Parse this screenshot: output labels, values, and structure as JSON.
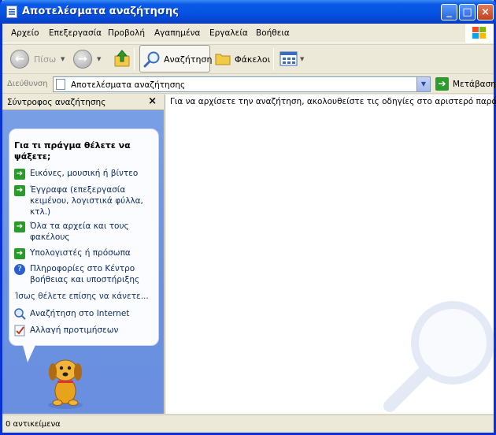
{
  "window": {
    "title": "Αποτελέσματα αναζήτησης"
  },
  "menu": [
    "Αρχείο",
    "Επεξεργασία",
    "Προβολή",
    "Αγαπημένα",
    "Εργαλεία",
    "Βοήθεια"
  ],
  "toolbar": {
    "back_label": "Πίσω",
    "search_label": "Αναζήτηση",
    "folders_label": "Φάκελοι"
  },
  "address": {
    "label": "Διεύθυνση",
    "value": "Αποτελέσματα αναζήτησης",
    "go_label": "Μετάβαση"
  },
  "search_pane": {
    "header": "Σύντροφος αναζήτησης",
    "close_symbol": "×",
    "question": "Για τι πράγμα θέλετε να ψάξετε;",
    "options": [
      "Εικόνες, μουσική ή βίντεο",
      "Έγγραφα (επεξεργασία κειμένου, λογιστικά φύλλα, κτλ.)",
      "Όλα τα αρχεία και τους φακέλους",
      "Υπολογιστές ή πρόσωπα",
      "Πληροφορίες στο Κέντρο βοήθειας και υποστήριξης"
    ],
    "also_title": "Ίσως θέλετε επίσης να κάνετε...",
    "also_items": [
      "Αναζήτηση στο Internet",
      "Αλλαγή προτιμήσεων"
    ]
  },
  "results": {
    "instructions": "Για να αρχίσετε την αναζήτηση, ακολουθείστε τις οδηγίες στο αριστερό παράθυρο."
  },
  "status": {
    "text": "0 αντικείμενα"
  },
  "colors": {
    "title_blue": "#0554e3",
    "pane_blue": "#6b90e0",
    "chrome": "#ece9d8",
    "go_green": "#2e9b2e"
  }
}
